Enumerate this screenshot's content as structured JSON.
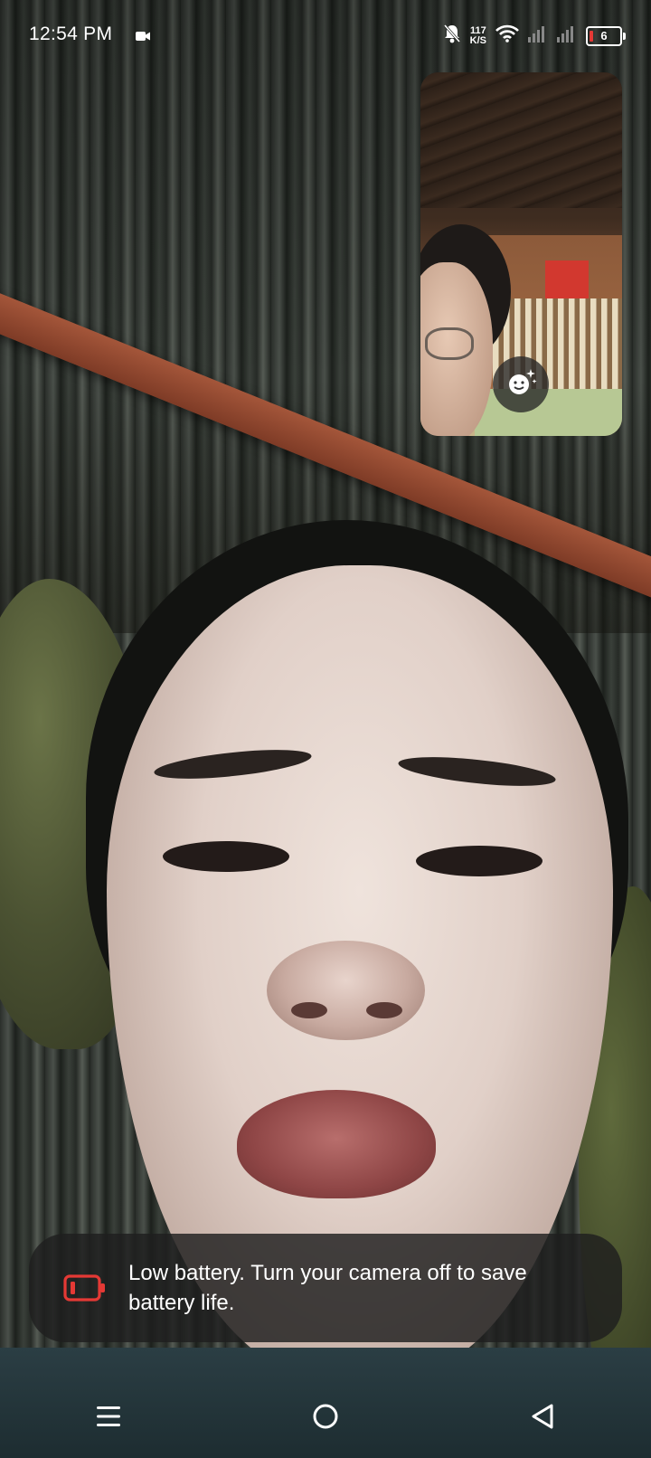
{
  "status_bar": {
    "time": "12:54 PM",
    "net_speed_value": "117",
    "net_speed_unit": "K/S",
    "battery_level": "6",
    "icons": [
      "video-camera-icon",
      "bell-off-icon",
      "wifi-icon",
      "signal-1-icon",
      "signal-2-icon",
      "battery-icon"
    ]
  },
  "self_preview": {
    "effects_icon": "face-effects-icon"
  },
  "toast": {
    "icon": "low-battery-icon",
    "message": "Low battery. Turn your camera off to save battery life.",
    "icon_color": "#e53935"
  },
  "nav_bar": {
    "icons": [
      "menu-icon",
      "home-icon",
      "back-icon"
    ]
  }
}
